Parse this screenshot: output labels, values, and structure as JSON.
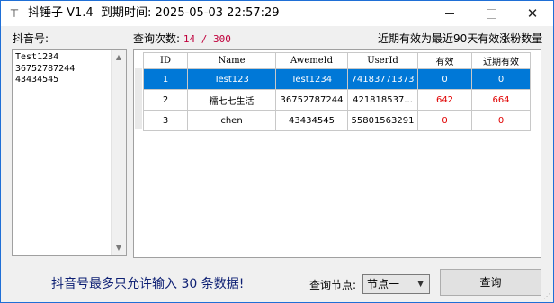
{
  "window": {
    "app_name": "抖锤子 V1.4",
    "expiry_label": "到期时间:",
    "expiry_value": "2025-05-03 22:57:29"
  },
  "labels": {
    "douyin_id": "抖音号:",
    "query_count_label": "查询次数:",
    "query_count_value": "14 / 300",
    "recent_note": "近期有效为最近90天有效涨粉数量"
  },
  "douyin_ids": "Test1234\n36752787244\n43434545",
  "table": {
    "columns": [
      "ID",
      "Name",
      "AwemeId",
      "UserId",
      "有效",
      "近期有效"
    ],
    "rows": [
      {
        "id": "1",
        "name": "Test123",
        "aweme_id": "Test1234",
        "user_id": "74183771373",
        "valid": "0",
        "recent": "0"
      },
      {
        "id": "2",
        "name": "糯七七生活",
        "aweme_id": "36752787244",
        "user_id": "421818537...",
        "valid": "642",
        "recent": "664"
      },
      {
        "id": "3",
        "name": "chen",
        "aweme_id": "43434545",
        "user_id": "55801563291",
        "valid": "0",
        "recent": "0"
      }
    ]
  },
  "footer": {
    "notice": "抖音号最多只允许输入 30 条数据!",
    "node_label": "查询节点:",
    "node_selected": "节点一",
    "query_button": "查询"
  },
  "colors": {
    "selection": "#0078d7",
    "count_red": "#e00000",
    "notice_blue": "#0d1f73"
  }
}
